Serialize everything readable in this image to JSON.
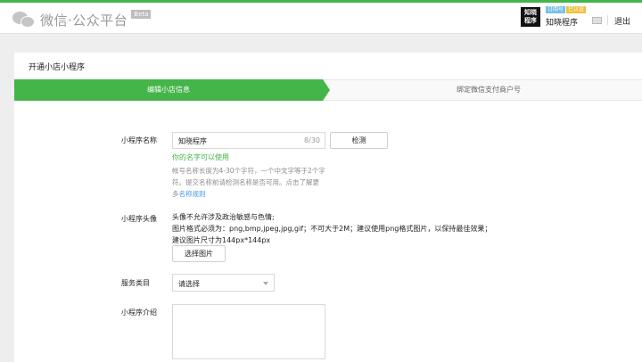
{
  "header": {
    "logo_text": "微信·公众平台",
    "beta": "Beta",
    "account_avatar": "知晓程序",
    "tag_subscription": "订阅号",
    "tag_verified": "已认证",
    "account_name": "知晓程序",
    "logout": "退出",
    "brand_color": "#44b549"
  },
  "main": {
    "title": "开通小店小程序",
    "steps": [
      "编辑小店信息",
      "绑定微信支付商户号"
    ]
  },
  "form": {
    "name_label": "小程序名称",
    "name_value": "知晓程序",
    "name_count": "8/30",
    "check_button": "检测",
    "name_ok": "你的名字可以使用",
    "name_hint": "帐号名称长度为4-30个字符，一个中文字等于2个字符。提交名称前请检测名称是否可用。点击了解更多",
    "name_rules_link": "名称规则",
    "avatar_label": "小程序头像",
    "avatar_desc": [
      "头像不允许涉及政治敏感与色情;",
      "图片格式必须为：png,bmp,jpeg,jpg,gif；不可大于2M；建议使用png格式图片，以保持最佳效果；",
      "建议图片尺寸为144px*144px"
    ],
    "choose_image_button": "选择图片",
    "category_label": "服务类目",
    "category_value": "请选择",
    "intro_label": "小程序介绍",
    "intro_value": ""
  }
}
